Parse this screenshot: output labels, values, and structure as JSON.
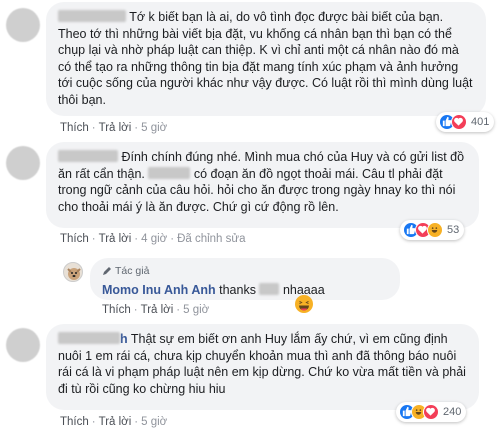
{
  "comments": [
    {
      "text": "Tớ k biết bạn là ai, do vô tình đọc được bài biết của bạn. Theo tớ thì những bài viết bịa đặt, vu khống cá nhân bạn thì bạn có thể chụp lại và nhờ pháp luật can thiệp. K vì chỉ anti một cá nhân nào đó mà có thể tạo ra những thông tin bịa đặt mang tính xúc phạm và ảnh hưởng tới cuộc sống của người khác như vậy được. Có luật rồi thì mình dùng luật thôi bạn.",
      "actions": {
        "like": "Thích",
        "reply": "Trả lời",
        "time": "5 giờ"
      },
      "reaction_count": "401"
    },
    {
      "text_part1": "Đính chính đúng nhé. Mình mua chó của Huy và có gửi list đồ ăn rất cẩn thận.",
      "text_part2": "có đoạn ăn đồ ngọt thoải mái. Câu tl phải đặt trong ngữ cảnh của câu hỏi. hỏi cho ăn được trong ngày hnay ko thì nói cho thoải mái ý là ăn được. Chứ gì cứ động rồ lên.",
      "actions": {
        "like": "Thích",
        "reply": "Trả lời",
        "time": "4 giờ",
        "edited": "Đã chỉnh sửa"
      },
      "reaction_count": "53"
    },
    {
      "author_tag": "Tác giả",
      "author_name": "Momo Inu Anh Anh",
      "text_before": "thanks",
      "text_after": "nhaaaa",
      "actions": {
        "like": "Thích",
        "reply": "Trả lời",
        "time": "5 giờ"
      }
    },
    {
      "name_suffix": "h",
      "text": "Thật sự em biết ơn anh Huy lắm ấy chứ, vì em cũng định nuôi 1 em rái cá, chưa kịp chuyển khoản mua thì anh đã thông báo nuôi rái cá là vi phạm pháp luật nên em kịp dừng. Chứ ko vừa mất tiền và phải đi tù rồi cũng ko chừng hiu hiu",
      "actions": {
        "like": "Thích",
        "reply": "Trả lời",
        "time": "5 giờ"
      },
      "reaction_count": "240"
    }
  ],
  "colors": {
    "name": "#385898",
    "bubble": "#f2f3f5",
    "like": "#1877f2",
    "love": "#f33e58",
    "haha": "#f7b125"
  }
}
